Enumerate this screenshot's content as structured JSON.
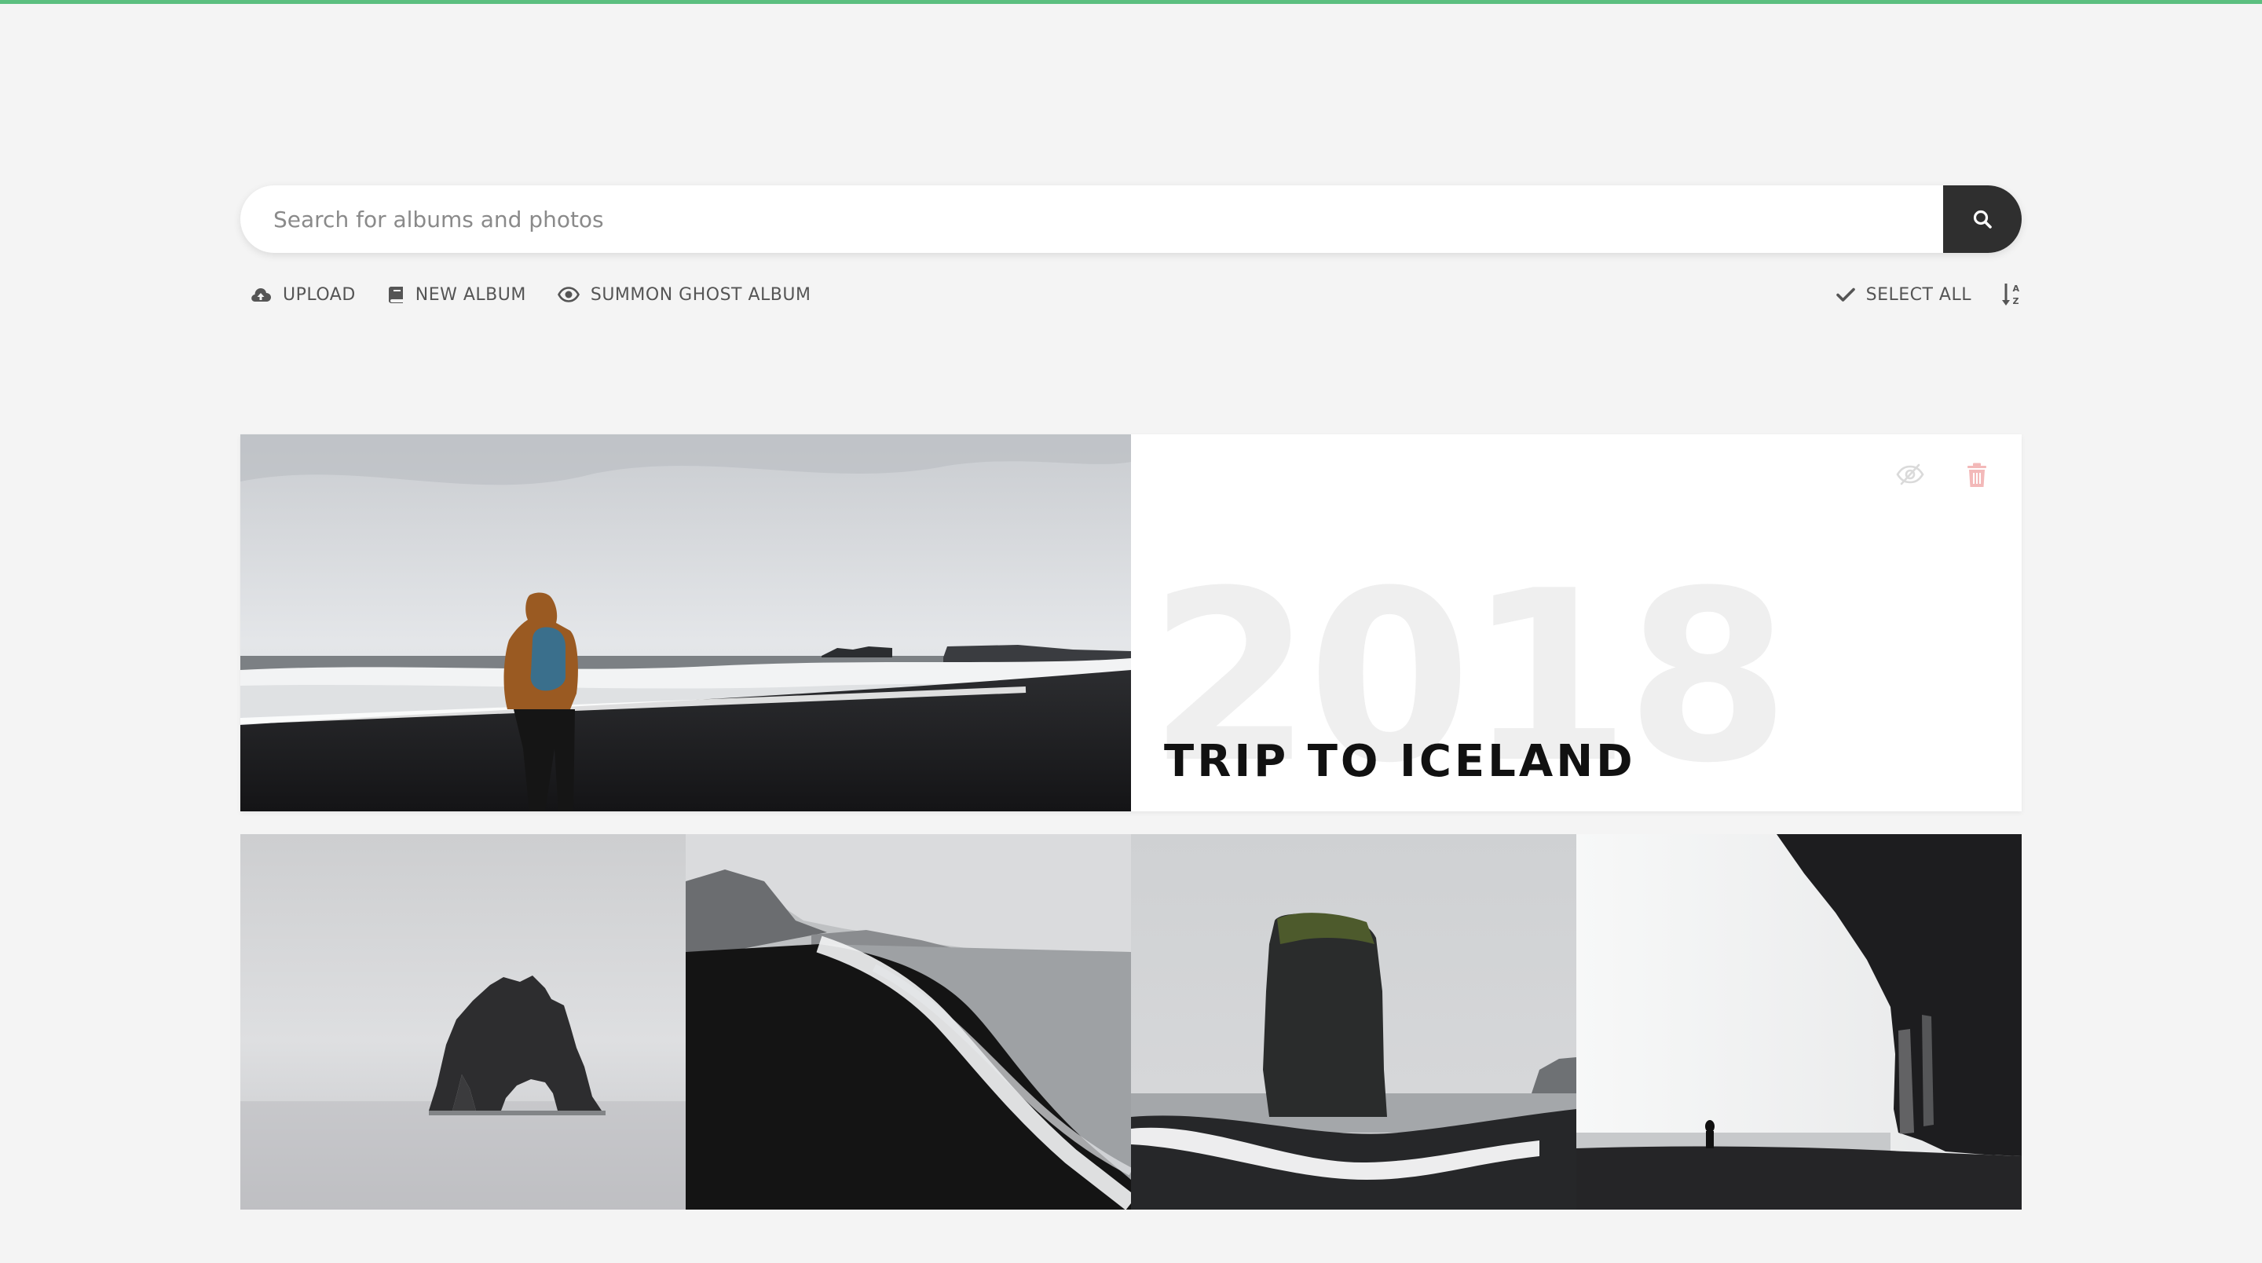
{
  "search": {
    "placeholder": "Search for albums and photos"
  },
  "toolbar": {
    "upload": "UPLOAD",
    "new_album": "NEW ALBUM",
    "summon_ghost": "SUMMON GHOST ALBUM",
    "select_all": "SELECT ALL"
  },
  "album": {
    "year": "2018",
    "title": "TRIP TO ICELAND"
  },
  "icons": {
    "search": "search-icon",
    "upload": "cloud-upload-icon",
    "new_album": "book-icon",
    "summon_ghost": "eye-icon",
    "select_all": "check-icon",
    "sort": "sort-alpha-icon",
    "hide": "eye-slash-icon",
    "delete": "trash-icon"
  },
  "colors": {
    "accent": "#5bbf7f",
    "background": "#f4f4f4",
    "search_button": "#2f2f2f",
    "delete_icon": "#f3b9b9"
  }
}
